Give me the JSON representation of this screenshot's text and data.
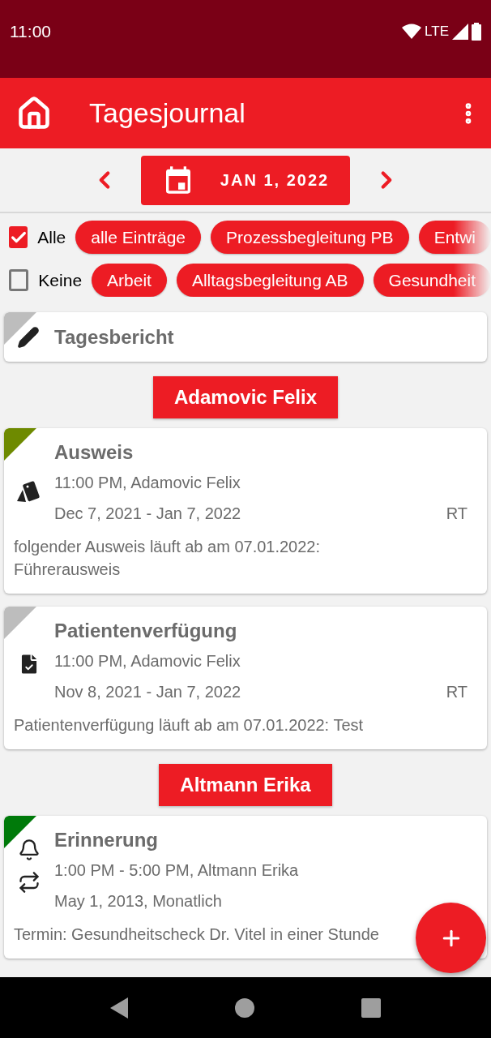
{
  "status_bar": {
    "time": "11:00",
    "network": "LTE"
  },
  "app_bar": {
    "title": "Tagesjournal"
  },
  "date_nav": {
    "date": "JAN 1, 2022"
  },
  "filters": [
    {
      "label": "Alle",
      "checked": true,
      "chips": [
        "alle Einträge",
        "Prozessbegleitung PB",
        "Entwi"
      ]
    },
    {
      "label": "Keine",
      "checked": false,
      "chips": [
        "Arbeit",
        "Alltagsbegleitung AB",
        "Gesundheit"
      ]
    }
  ],
  "report": {
    "label": "Tagesbericht",
    "color": "#bdbdbd"
  },
  "groups": [
    {
      "person": "Adamovic Felix",
      "entries": [
        {
          "kind": "id-card",
          "color": "#6e8a00",
          "title": "Ausweis",
          "time": "11:00 PM, Adamovic Felix",
          "dates": "Dec 7, 2021 - Jan 7, 2022",
          "code": "RT",
          "description": "folgender Ausweis läuft ab am 07.01.2022: Führerausweis"
        },
        {
          "kind": "document",
          "color": "#bdbdbd",
          "title": "Patientenverfügung",
          "time": "11:00 PM, Adamovic Felix",
          "dates": "Nov 8, 2021 - Jan 7, 2022",
          "code": "RT",
          "description": "Patientenverfügung läuft ab am 07.01.2022: Test"
        }
      ]
    },
    {
      "person": "Altmann Erika",
      "entries": [
        {
          "kind": "reminder",
          "color": "#007a0a",
          "title": "Erinnerung",
          "time": "1:00 PM - 5:00 PM, Altmann Erika",
          "dates": "May 1, 2013, Monatlich",
          "description": "Termin: Gesundheitscheck Dr. Vitel in einer Stunde"
        }
      ]
    }
  ]
}
